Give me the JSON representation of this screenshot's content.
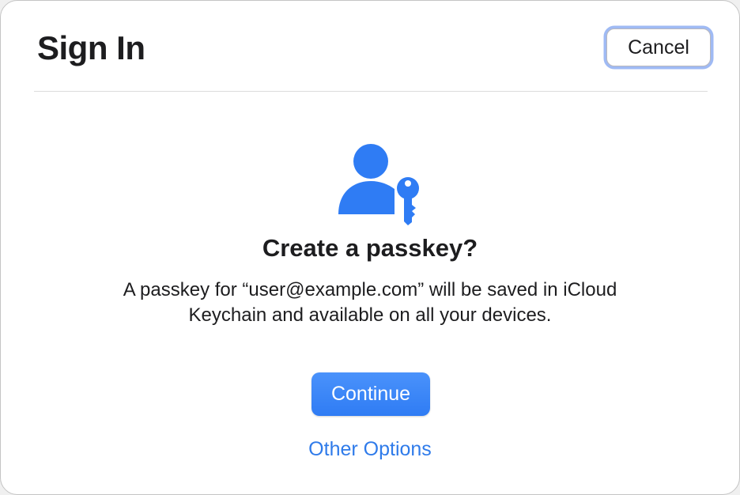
{
  "sheet": {
    "title": "Sign In",
    "cancel_label": "Cancel"
  },
  "content": {
    "icon": "person-key-icon",
    "heading": "Create a passkey?",
    "message_lines": [
      "A passkey for “user@example.com” will be saved in iCloud",
      "Keychain and available on all your devices."
    ],
    "continue_label": "Continue",
    "other_options_label": "Other Options"
  },
  "colors": {
    "accent": "#2f7cf4",
    "link": "#2f7bea",
    "text": "#1d1d1f",
    "focus_ring": "#5082eb"
  }
}
